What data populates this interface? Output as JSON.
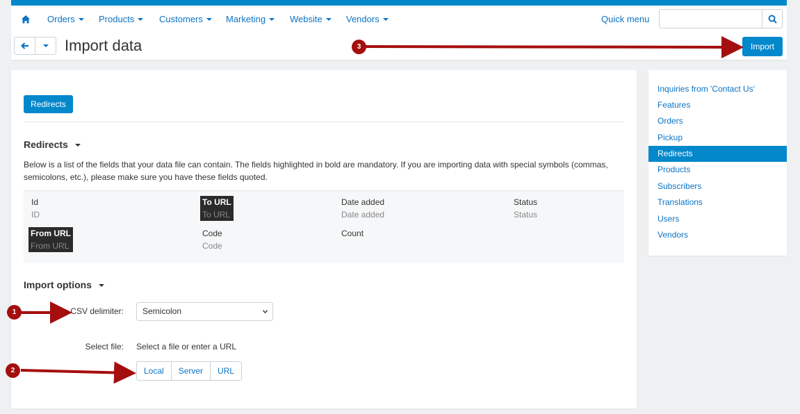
{
  "nav": {
    "items": [
      {
        "label": "Orders"
      },
      {
        "label": "Products"
      },
      {
        "label": "Customers"
      },
      {
        "label": "Marketing"
      },
      {
        "label": "Website"
      },
      {
        "label": "Vendors"
      }
    ],
    "quick_menu": "Quick menu",
    "search_placeholder": ""
  },
  "header": {
    "title": "Import data",
    "import_label": "Import"
  },
  "main": {
    "tab_label": "Redirects",
    "fields_section_title": "Redirects",
    "description": "Below is a list of the fields that your data file can contain. The fields highlighted in bold are mandatory. If you are importing data with special symbols (commas, semicolons, etc.), please make sure you have these fields quoted.",
    "fields": [
      {
        "name": "Id",
        "sub": "ID",
        "mandatory": false
      },
      {
        "name": "To URL",
        "sub": "To URL",
        "mandatory": true
      },
      {
        "name": "Date added",
        "sub": "Date added",
        "mandatory": false
      },
      {
        "name": "Status",
        "sub": "Status",
        "mandatory": false
      },
      {
        "name": "From URL",
        "sub": "From URL",
        "mandatory": true
      },
      {
        "name": "Code",
        "sub": "Code",
        "mandatory": false
      },
      {
        "name": "Count",
        "sub": "",
        "mandatory": false
      }
    ],
    "options_title": "Import options",
    "csv_label": "CSV delimiter:",
    "csv_value": "Semicolon",
    "file_label": "Select file:",
    "file_text": "Select a file or enter a URL",
    "file_buttons": [
      "Local",
      "Server",
      "URL"
    ]
  },
  "sidebar": {
    "items": [
      {
        "label": "Inquiries from 'Contact Us'",
        "active": false
      },
      {
        "label": "Features",
        "active": false
      },
      {
        "label": "Orders",
        "active": false
      },
      {
        "label": "Pickup",
        "active": false
      },
      {
        "label": "Redirects",
        "active": true
      },
      {
        "label": "Products",
        "active": false
      },
      {
        "label": "Subscribers",
        "active": false
      },
      {
        "label": "Translations",
        "active": false
      },
      {
        "label": "Users",
        "active": false
      },
      {
        "label": "Vendors",
        "active": false
      }
    ]
  },
  "annotations": [
    "1",
    "2",
    "3"
  ],
  "colors": {
    "accent": "#0388cc",
    "link": "#0c73c4",
    "annotation": "#a50e0e"
  }
}
